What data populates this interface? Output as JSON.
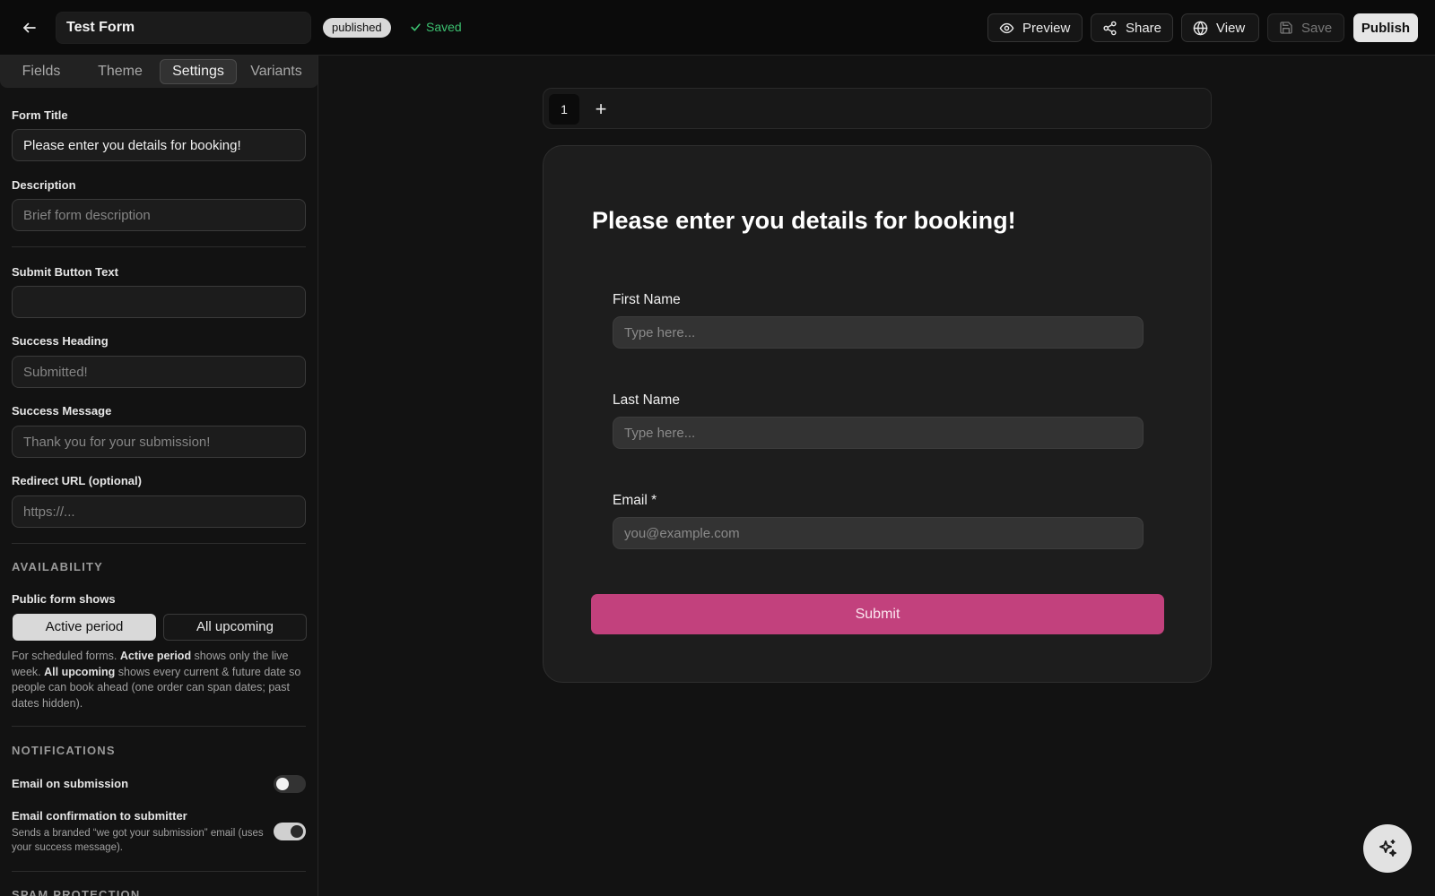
{
  "header": {
    "form_name": "Test Form",
    "status_badge": "published",
    "saved_text": "Saved",
    "preview_label": "Preview",
    "share_label": "Share",
    "view_label": "View",
    "save_label": "Save",
    "publish_label": "Publish"
  },
  "sidebar": {
    "tabs": [
      "Fields",
      "Theme",
      "Settings",
      "Variants"
    ],
    "active_tab": "Settings",
    "form_title_label": "Form Title",
    "form_title_value": "Please enter you details for booking!",
    "description_label": "Description",
    "description_placeholder": "Brief form description",
    "submit_text_label": "Submit Button Text",
    "submit_text_value": "",
    "success_heading_label": "Success Heading",
    "success_heading_placeholder": "Submitted!",
    "success_message_label": "Success Message",
    "success_message_placeholder": "Thank you for your submission!",
    "redirect_label": "Redirect URL (optional)",
    "redirect_placeholder": "https://...",
    "availability_heading": "AVAILABILITY",
    "public_shows_label": "Public form shows",
    "option_active": "Active period",
    "option_upcoming": "All upcoming",
    "help_pre": "For scheduled forms. ",
    "help_b1": "Active period",
    "help_mid": " shows only the live week. ",
    "help_b2": "All upcoming",
    "help_post": " shows every current & future date so people can book ahead (one order can span dates; past dates hidden).",
    "notifications_heading": "NOTIFICATIONS",
    "email_submission_label": "Email on submission",
    "email_submission_on": false,
    "email_confirm_label": "Email confirmation to submitter",
    "email_confirm_help": "Sends a branded “we got your submission” email (uses your success message).",
    "email_confirm_on": true,
    "spam_heading": "SPAM PROTECTION"
  },
  "canvas": {
    "pages": [
      "1"
    ],
    "add_page": "+",
    "title": "Please enter you details for booking!",
    "fields": [
      {
        "label": "First Name",
        "placeholder": "Type here..."
      },
      {
        "label": "Last Name",
        "placeholder": "Type here..."
      },
      {
        "label": "Email *",
        "placeholder": "you@example.com"
      }
    ],
    "submit_label": "Submit"
  },
  "colors": {
    "accent_submit": "#c2417d",
    "saved_green": "#3cc070",
    "background": "#121212"
  },
  "icons": {
    "back": "arrow-left-icon",
    "saved": "check-icon",
    "preview": "eye-icon",
    "share": "share-icon",
    "view": "globe-icon",
    "save": "floppy-disk-icon",
    "assistant": "sparkles-icon"
  }
}
